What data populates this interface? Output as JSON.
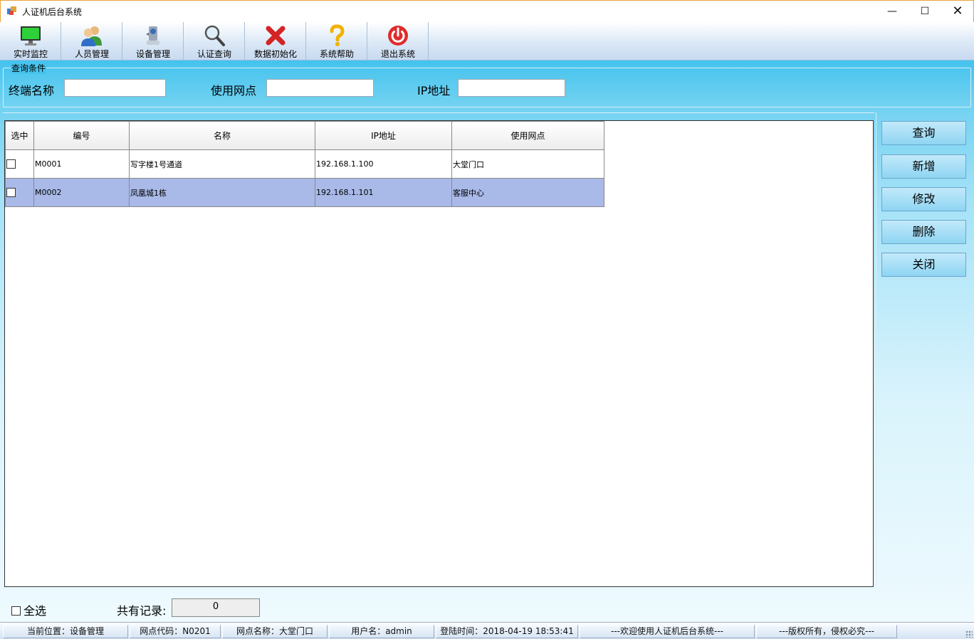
{
  "window": {
    "title": "人证机后台系统",
    "min": "—",
    "max": "☐",
    "close": "✕"
  },
  "toolbar": [
    {
      "label": "实时监控",
      "icon": "monitor-icon"
    },
    {
      "label": "人员管理",
      "icon": "users-icon"
    },
    {
      "label": "设备管理",
      "icon": "device-icon"
    },
    {
      "label": "认证查询",
      "icon": "search-icon"
    },
    {
      "label": "数据初始化",
      "icon": "red-x-icon"
    },
    {
      "label": "系统帮助",
      "icon": "help-icon"
    },
    {
      "label": "退出系统",
      "icon": "power-icon"
    }
  ],
  "query": {
    "legend": "查询条件",
    "terminal_label": "终端名称",
    "site_label": "使用网点",
    "ip_label": "IP地址",
    "terminal_value": "",
    "site_value": "",
    "ip_value": ""
  },
  "table": {
    "columns": [
      "选中",
      "编号",
      "名称",
      "IP地址",
      "使用网点"
    ],
    "rows": [
      {
        "checked": false,
        "code": "M0001",
        "name": "写字楼1号通道",
        "ip": "192.168.1.100",
        "site": "大堂门口"
      },
      {
        "checked": false,
        "code": "M0002",
        "name": "凤凰城1栋",
        "ip": "192.168.1.101",
        "site": "客服中心"
      }
    ]
  },
  "side_buttons": {
    "query": "查询",
    "add": "新增",
    "edit": "修改",
    "delete": "删除",
    "close": "关闭"
  },
  "footer": {
    "select_all": "全选",
    "record_label": "共有记录:",
    "record_count": "0"
  },
  "status": {
    "location": "当前位置：设备管理",
    "site_code": "网点代码：N0201",
    "site_name": "网点名称：大堂门口",
    "user": "用户名：admin",
    "login_time": "登陆时间：2018-04-19 18:53:41",
    "welcome": "---欢迎使用人证机后台系统---",
    "copyright": "---版权所有，侵权必究---"
  },
  "colors": {
    "accent_blue": "#44c3ee",
    "selected_row": "#a9b9e8",
    "window_border": "#e8a33a"
  }
}
